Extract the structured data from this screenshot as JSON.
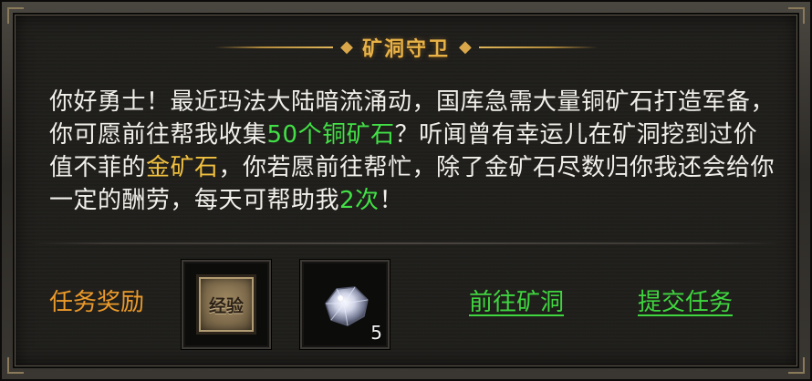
{
  "panel": {
    "title": "矿洞守卫",
    "ornament_left": "◆",
    "ornament_right": "◆"
  },
  "dialog": {
    "part1": "你好勇士！最近玛法大陆暗流涌动，国库急需大量铜矿石打造军备，你可愿前往帮我收集",
    "highlight_copper": "50个铜矿石",
    "part2": "？听闻曾有幸运儿在矿洞挖到过价值不菲的",
    "highlight_gold": "金矿石",
    "part3": "，你若愿前往帮忙，除了金矿石尽数归你我还会给你一定的酬劳，每天可帮助我",
    "highlight_times": "2次",
    "part4": "！"
  },
  "rewards": {
    "label": "任务奖励",
    "items": [
      {
        "name": "经验",
        "icon": "exp-badge-icon"
      },
      {
        "name": "gem",
        "icon": "diamond-ore-icon",
        "quantity": "5"
      }
    ]
  },
  "actions": {
    "goto_mine": "前往矿洞",
    "submit_quest": "提交任务"
  },
  "colors": {
    "title": "#e8b247",
    "text": "#f2f0ea",
    "highlight_green": "#42e046",
    "highlight_gold": "#f0c040",
    "reward_label": "#ec9a2a",
    "link": "#3fd63f"
  }
}
